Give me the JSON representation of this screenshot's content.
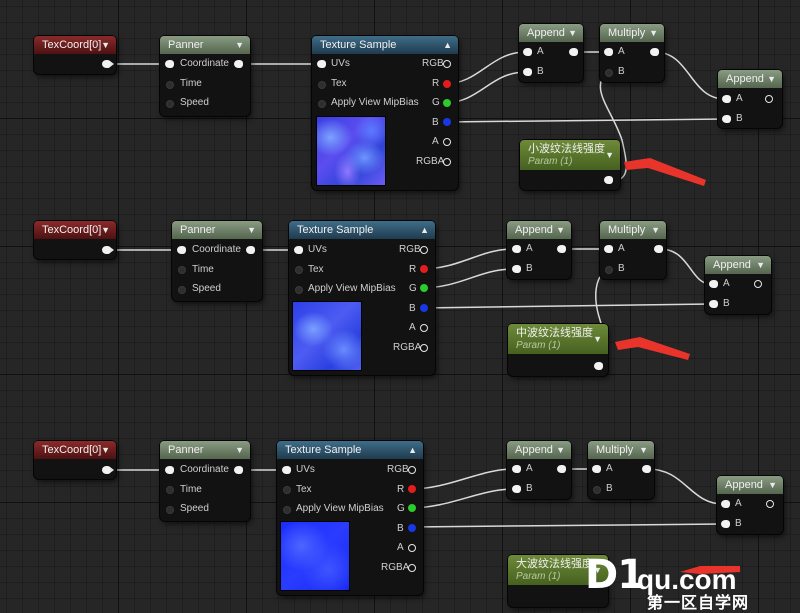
{
  "colors": {
    "exec_pin": "#f2f2f2",
    "r_pin": "#e31d1d",
    "g_pin": "#2bcc2b",
    "b_pin": "#1a37e6",
    "wire": "#d9d9d9",
    "annotation_arrow": "#e8342b"
  },
  "nodes": {
    "texcoord": {
      "title": "TexCoord[0]"
    },
    "panner": {
      "title": "Panner",
      "pins": [
        "Coordinate",
        "Time",
        "Speed"
      ]
    },
    "texture_sample": {
      "title": "Texture Sample",
      "inputs": [
        "UVs",
        "Tex",
        "Apply View MipBias"
      ],
      "outputs": [
        "RGB",
        "R",
        "G",
        "B",
        "A",
        "RGBA"
      ]
    },
    "append": {
      "title": "Append",
      "pins": [
        "A",
        "B"
      ]
    },
    "multiply": {
      "title": "Multiply",
      "pins": [
        "A",
        "B"
      ]
    },
    "param_subtitle": "Param (1)"
  },
  "groups": [
    {
      "param_title": "小波纹法线强度"
    },
    {
      "param_title": "中波纹法线强度"
    },
    {
      "param_title": "大波纹法线强度"
    }
  ],
  "icons": {
    "chevron": "chevron-down-icon",
    "collapse": "chevron-up-icon"
  },
  "watermark": {
    "logo": "D1",
    "domain": "qu.com",
    "tagline": "第一区自学网"
  }
}
